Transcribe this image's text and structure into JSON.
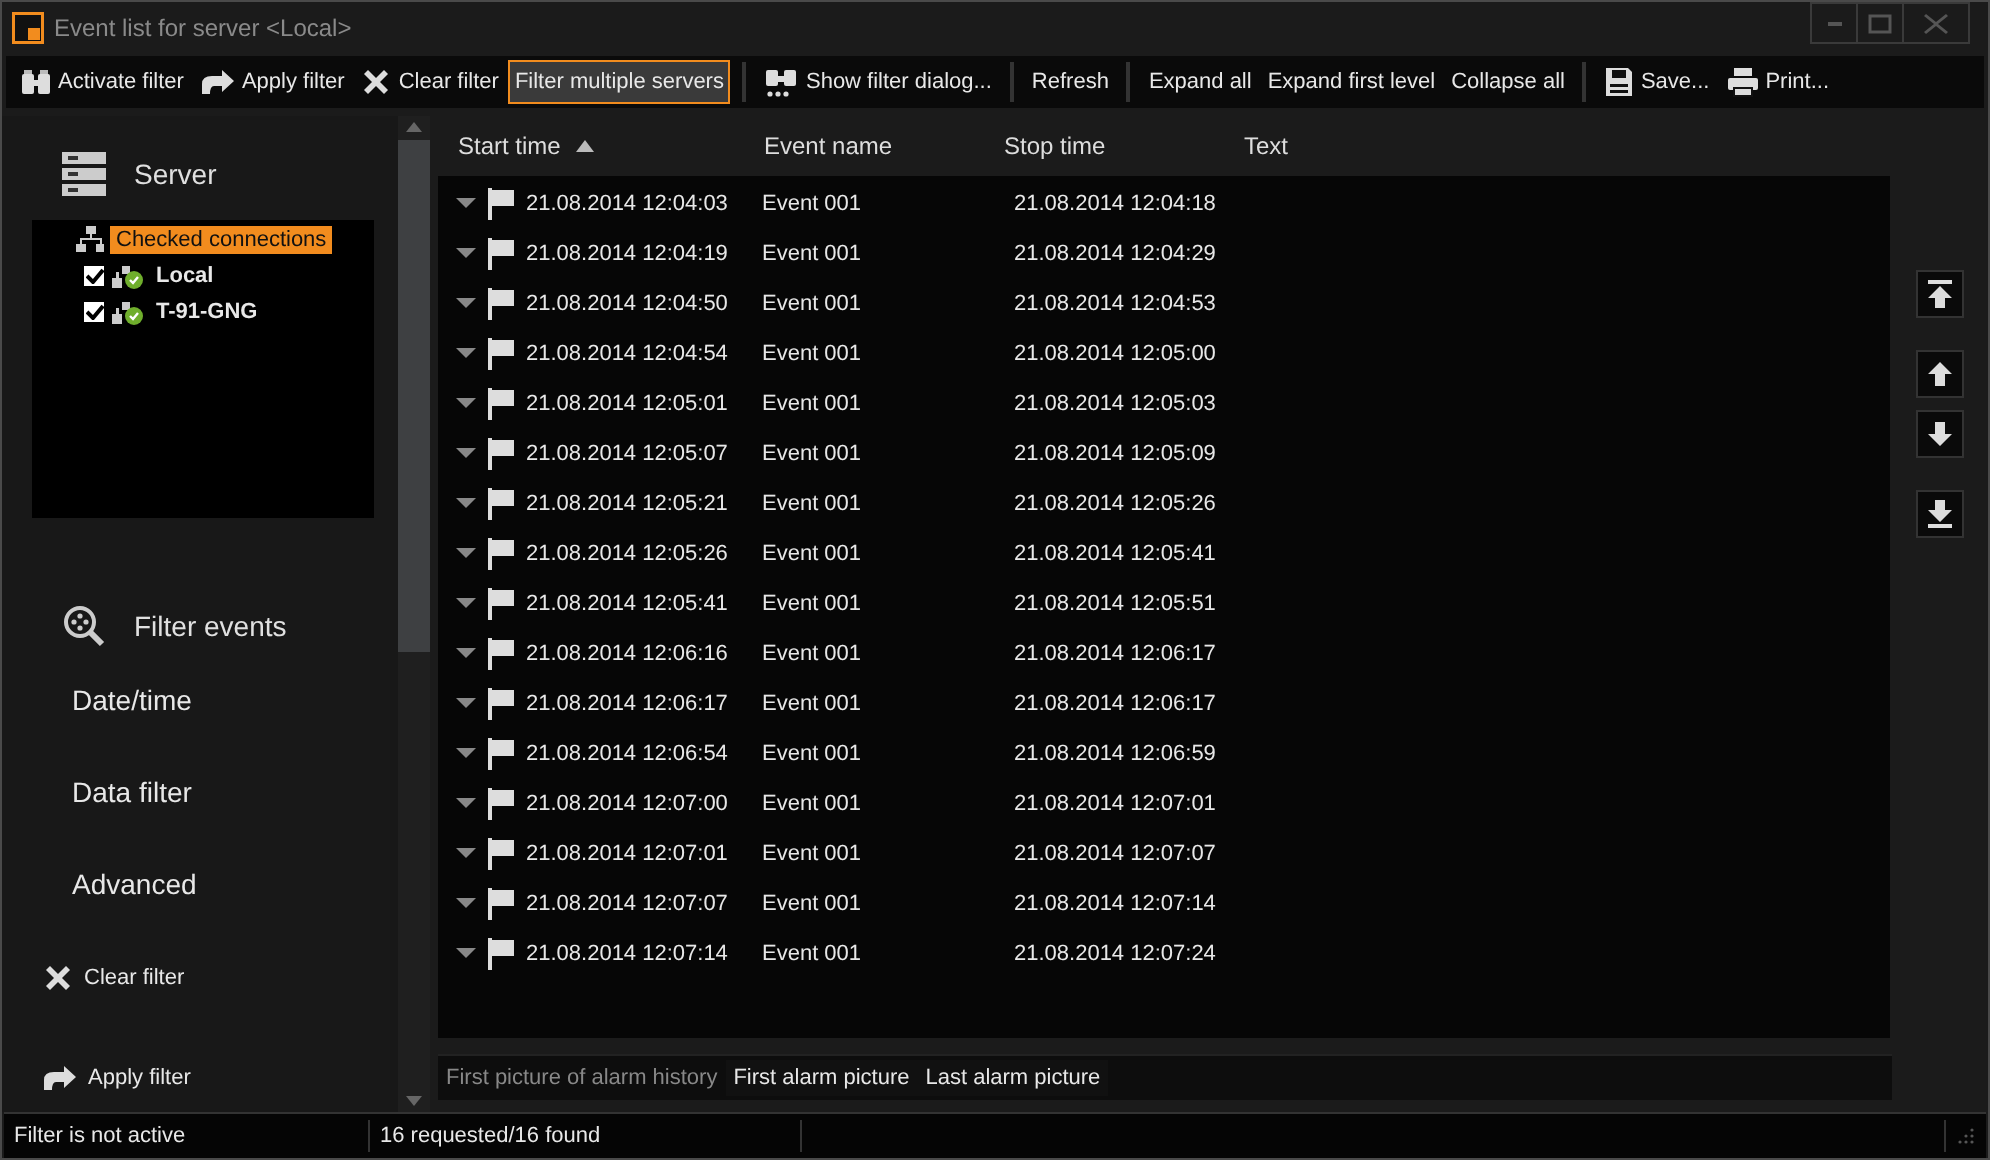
{
  "window": {
    "title": "Event list for server <Local>"
  },
  "toolbar": [
    {
      "label": "Activate filter",
      "kind": "binoculars",
      "active": false
    },
    {
      "label": "Apply filter",
      "kind": "redo",
      "active": false
    },
    {
      "label": "Clear filter",
      "kind": "cross",
      "active": false
    },
    {
      "label": "Filter multiple servers",
      "kind": "text",
      "active": true,
      "separator_after": true
    },
    {
      "label": "Show filter dialog...",
      "kind": "binoculars-dots",
      "active": false,
      "separator_after": true
    },
    {
      "label": "Refresh",
      "kind": "text",
      "active": false,
      "separator_after": true
    },
    {
      "label": "Expand all",
      "kind": "text",
      "active": false
    },
    {
      "label": "Expand first level",
      "kind": "text",
      "active": false
    },
    {
      "label": "Collapse all",
      "kind": "text",
      "active": false,
      "separator_after": true
    },
    {
      "label": "Save...",
      "kind": "floppy",
      "active": false
    },
    {
      "label": "Print...",
      "kind": "printer",
      "active": false
    }
  ],
  "sidebar": {
    "server_title": "Server",
    "server_tree": [
      {
        "label": "Checked connections",
        "selected": true,
        "children": [
          {
            "label": "Local",
            "checked": true,
            "selected": false
          },
          {
            "label": "T-91-GNG",
            "checked": true,
            "selected": false
          }
        ]
      }
    ],
    "filter_title": "Filter events",
    "filter_items": [
      "Date/time",
      "Data filter",
      "Advanced"
    ],
    "actions": [
      {
        "label": "Clear filter",
        "kind": "cross"
      },
      {
        "label": "Apply filter",
        "kind": "redo"
      }
    ]
  },
  "table": {
    "columns": [
      {
        "label": "Start time",
        "sorted": true
      },
      {
        "label": "Event name",
        "sorted": false
      },
      {
        "label": "Stop time",
        "sorted": false
      },
      {
        "label": "Text",
        "sorted": false
      }
    ],
    "rows": [
      [
        "21.08.2014 12:04:03",
        "Event 001",
        "21.08.2014 12:04:18"
      ],
      [
        "21.08.2014 12:04:19",
        "Event 001",
        "21.08.2014 12:04:29"
      ],
      [
        "21.08.2014 12:04:50",
        "Event 001",
        "21.08.2014 12:04:53"
      ],
      [
        "21.08.2014 12:04:54",
        "Event 001",
        "21.08.2014 12:05:00"
      ],
      [
        "21.08.2014 12:05:01",
        "Event 001",
        "21.08.2014 12:05:03"
      ],
      [
        "21.08.2014 12:05:07",
        "Event 001",
        "21.08.2014 12:05:09"
      ],
      [
        "21.08.2014 12:05:21",
        "Event 001",
        "21.08.2014 12:05:26"
      ],
      [
        "21.08.2014 12:05:26",
        "Event 001",
        "21.08.2014 12:05:41"
      ],
      [
        "21.08.2014 12:05:41",
        "Event 001",
        "21.08.2014 12:05:51"
      ],
      [
        "21.08.2014 12:06:16",
        "Event 001",
        "21.08.2014 12:06:17"
      ],
      [
        "21.08.2014 12:06:17",
        "Event 001",
        "21.08.2014 12:06:17"
      ],
      [
        "21.08.2014 12:06:54",
        "Event 001",
        "21.08.2014 12:06:59"
      ],
      [
        "21.08.2014 12:07:00",
        "Event 001",
        "21.08.2014 12:07:01"
      ],
      [
        "21.08.2014 12:07:01",
        "Event 001",
        "21.08.2014 12:07:07"
      ],
      [
        "21.08.2014 12:07:07",
        "Event 001",
        "21.08.2014 12:07:14"
      ],
      [
        "21.08.2014 12:07:14",
        "Event 001",
        "21.08.2014 12:07:24"
      ]
    ]
  },
  "picture_buttons": [
    {
      "label": "First picture of alarm history",
      "disabled": true
    },
    {
      "label": "First alarm picture",
      "disabled": false
    },
    {
      "label": "Last alarm picture",
      "disabled": false
    }
  ],
  "status_bar": [
    "Filter is not active",
    "16 requested/16 found"
  ]
}
